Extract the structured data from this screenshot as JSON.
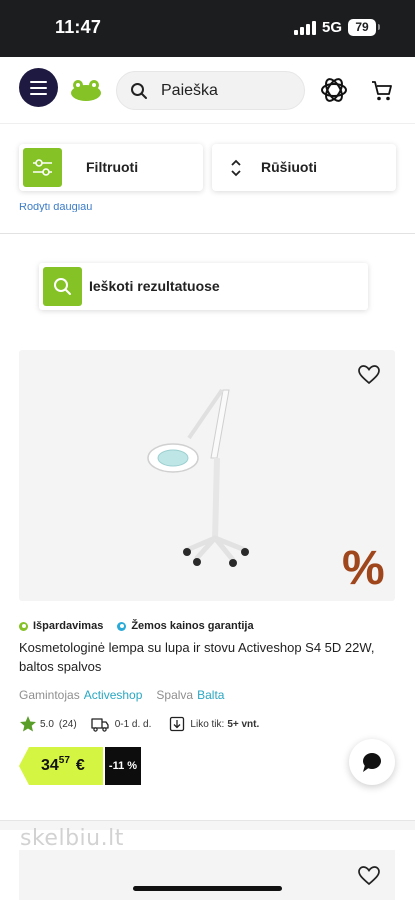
{
  "status_bar": {
    "time": "11:47",
    "network": "5G",
    "battery": "79"
  },
  "header": {
    "search_placeholder": "Paieška",
    "icons": [
      "menu-icon",
      "frog-logo",
      "search-icon",
      "ai-assistant-icon",
      "cart-icon"
    ]
  },
  "toolbar": {
    "filter_label": "Filtruoti",
    "sort_label": "Rūšiuoti",
    "partial_link": "Rodyti daugiau"
  },
  "search_in_results": {
    "label": "Ieškoti rezultatuose"
  },
  "product": {
    "badges": [
      "Išpardavimas",
      "Žemos kainos garantija"
    ],
    "title": "Kosmetologinė lempa su lupa ir stovu Activeshop S4 5D 22W, baltos spalvos",
    "manufacturer_label": "Gamintojas",
    "manufacturer": "Activeshop",
    "color_label": "Spalva",
    "color": "Balta",
    "rating": "5.0",
    "reviews": "(24)",
    "delivery": "0-1 d. d.",
    "stock_label": "Liko tik:",
    "stock_value": "5+ vnt.",
    "price_whole": "34",
    "price_cents": "57",
    "currency": "€",
    "discount": "-11 %",
    "sale_symbol": "%"
  },
  "watermark": "skelbiu.lt",
  "colors": {
    "brand_green": "#84c225",
    "brand_navy": "#1d1940",
    "sale_orange": "#a0461c",
    "link_teal": "#2aa7c2",
    "price_tag": "#d4f542"
  }
}
